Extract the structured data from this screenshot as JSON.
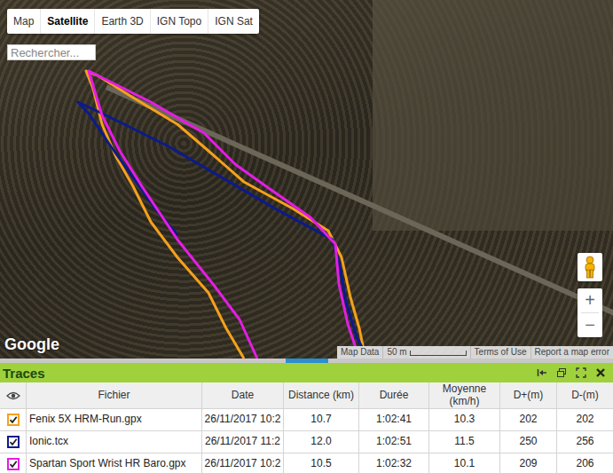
{
  "map": {
    "tabs": [
      {
        "label": "Map",
        "selected": false
      },
      {
        "label": "Satellite",
        "selected": true
      },
      {
        "label": "Earth 3D",
        "selected": false
      },
      {
        "label": "IGN Topo",
        "selected": false
      },
      {
        "label": "IGN Sat",
        "selected": false
      }
    ],
    "search": {
      "placeholder": "Rechercher..."
    },
    "logo": "Google",
    "zoom": {
      "in": "+",
      "out": "−"
    },
    "attribution": {
      "map_data": "Map Data",
      "scale": "50 m",
      "terms": "Terms of Use",
      "report": "Report a map error"
    }
  },
  "traces": {
    "title": "Traces",
    "columns": [
      "Fichier",
      "Date",
      "Distance (km)",
      "Durée",
      "Moyenne (km/h)",
      "D+(m)",
      "D-(m)"
    ],
    "rows": [
      {
        "file": "Fenix 5X HRM-Run.gpx",
        "date": "26/11/2017 10:2",
        "distance": "10.7",
        "duration": "1:02:41",
        "speed": "10.3",
        "ascent": "202",
        "descent": "202",
        "checked": true,
        "color": "#f5a11c"
      },
      {
        "file": "Ionic.tcx",
        "date": "26/11/2017 11:2",
        "distance": "12.0",
        "duration": "1:02:51",
        "speed": "11.5",
        "ascent": "250",
        "descent": "256",
        "checked": true,
        "color": "#0c1a8c"
      },
      {
        "file": "Spartan Sport Wrist HR Baro.gpx",
        "date": "26/11/2017 10:2",
        "distance": "10.5",
        "duration": "1:02:32",
        "speed": "10.1",
        "ascent": "209",
        "descent": "206",
        "checked": true,
        "color": "#e41de4"
      }
    ]
  }
}
